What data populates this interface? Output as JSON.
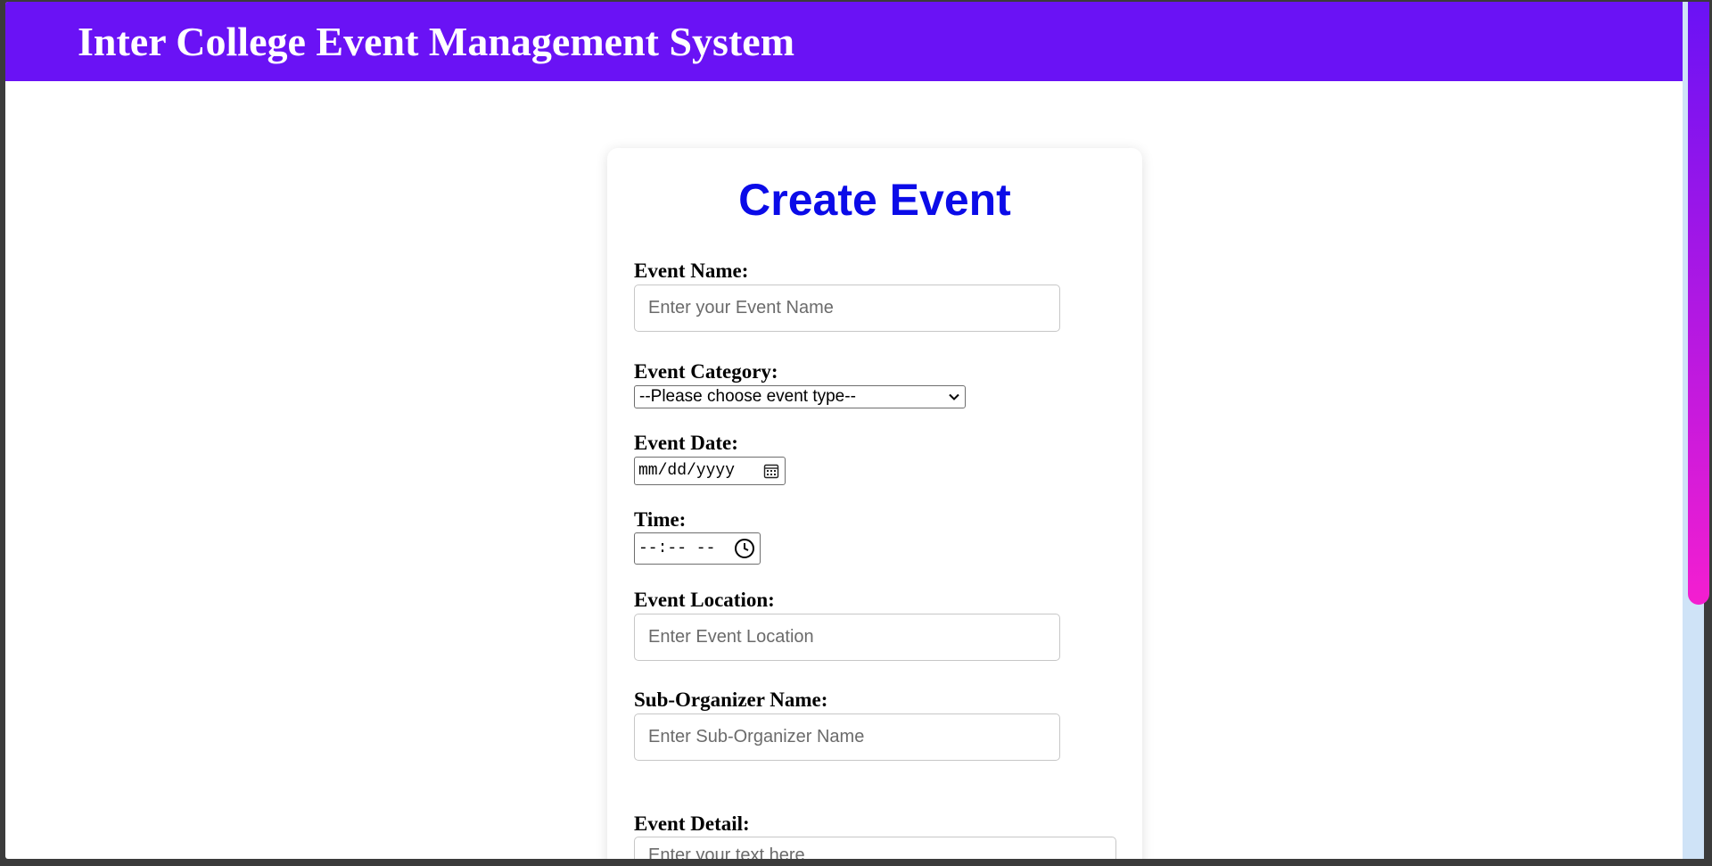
{
  "header": {
    "title": "Inter College Event Management System",
    "background": "#6a12f5"
  },
  "form": {
    "title": "Create Event",
    "title_color": "#0b0be8",
    "event_name": {
      "label": "Event Name:",
      "placeholder": "Enter your Event Name"
    },
    "event_category": {
      "label": "Event Category:",
      "selected": "--Please choose event type--"
    },
    "event_date": {
      "label": "Event Date:",
      "value": "mm/dd/yyyy"
    },
    "time": {
      "label": "Time:",
      "value": "--:-- --"
    },
    "event_location": {
      "label": "Event Location:",
      "placeholder": "Enter Event Location"
    },
    "sub_organizer": {
      "label": "Sub-Organizer Name:",
      "placeholder": "Enter Sub-Organizer Name"
    },
    "event_detail": {
      "label": "Event Detail:",
      "placeholder": "Enter your text here"
    }
  },
  "icons": {
    "select": "chevron-down-icon",
    "date": "calendar-icon",
    "time": "clock-icon"
  },
  "scrollbar": {
    "thumb_gradient": [
      "#6a12f5",
      "#f41ed0"
    ],
    "track_color": "#cfe3f7"
  }
}
